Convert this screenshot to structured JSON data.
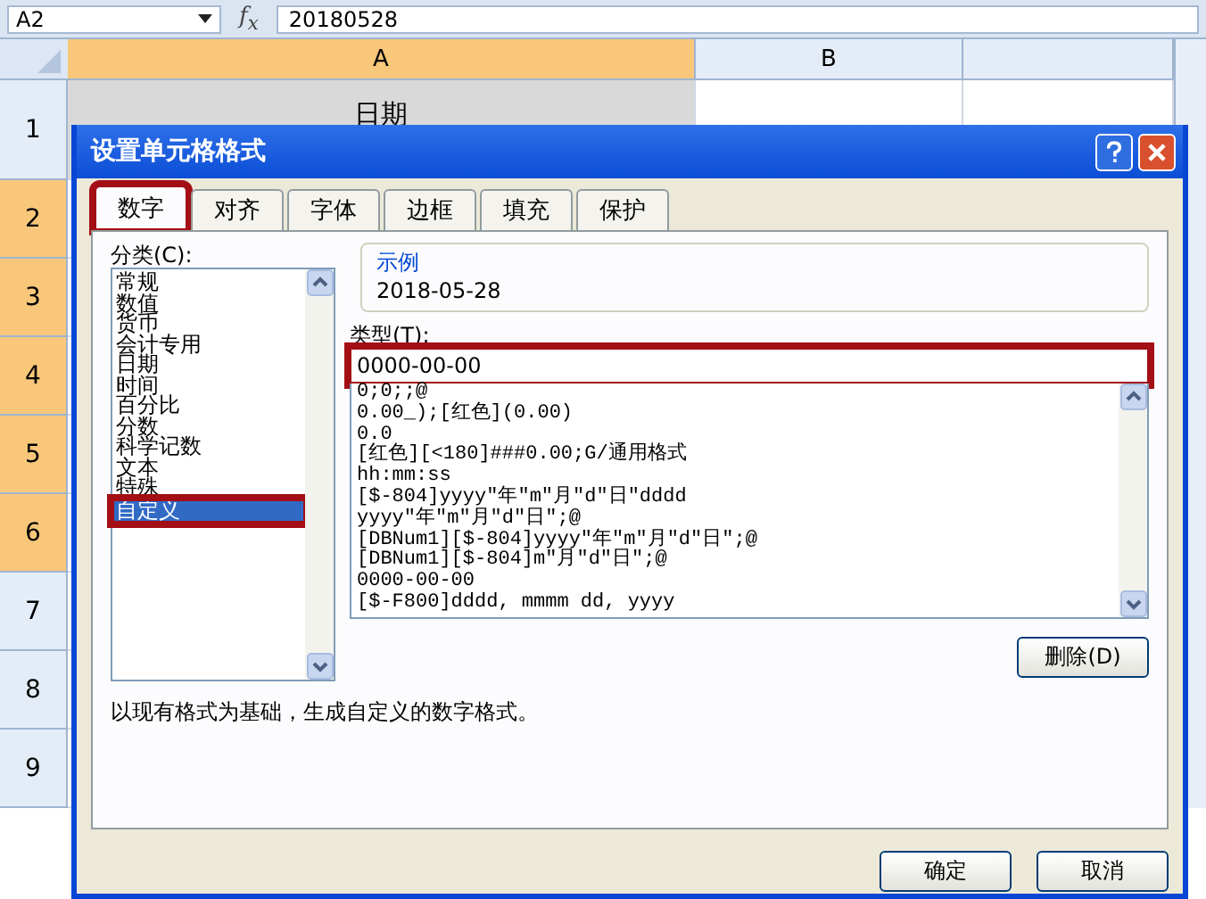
{
  "formula_bar": {
    "name_box": "A2",
    "fx": "f$_{x}$",
    "value": "20180528"
  },
  "columns": [
    {
      "label": "A",
      "selected": true
    },
    {
      "label": "B",
      "selected": false
    }
  ],
  "rows": [
    {
      "label": "1",
      "selected": false
    },
    {
      "label": "2",
      "selected": true
    },
    {
      "label": "3",
      "selected": true
    },
    {
      "label": "4",
      "selected": true
    },
    {
      "label": "5",
      "selected": true
    },
    {
      "label": "6",
      "selected": true
    },
    {
      "label": "7",
      "selected": false
    },
    {
      "label": "8",
      "selected": false
    },
    {
      "label": "9",
      "selected": false
    }
  ],
  "cell_a1": "日期",
  "dialog": {
    "title": "设置单元格格式",
    "tabs": [
      {
        "label": "数字",
        "selected": true,
        "annotated": true
      },
      {
        "label": "对齐",
        "selected": false,
        "annotated": false
      },
      {
        "label": "字体",
        "selected": false,
        "annotated": false
      },
      {
        "label": "边框",
        "selected": false,
        "annotated": false
      },
      {
        "label": "填充",
        "selected": false,
        "annotated": false
      },
      {
        "label": "保护",
        "selected": false,
        "annotated": false
      }
    ],
    "category_label": "分类(C):",
    "categories": [
      {
        "label": "常规",
        "selected": false,
        "annotated": false
      },
      {
        "label": "数值",
        "selected": false,
        "annotated": false
      },
      {
        "label": "货币",
        "selected": false,
        "annotated": false
      },
      {
        "label": "会计专用",
        "selected": false,
        "annotated": false
      },
      {
        "label": "日期",
        "selected": false,
        "annotated": false
      },
      {
        "label": "时间",
        "selected": false,
        "annotated": false
      },
      {
        "label": "百分比",
        "selected": false,
        "annotated": false
      },
      {
        "label": "分数",
        "selected": false,
        "annotated": false
      },
      {
        "label": "科学记数",
        "selected": false,
        "annotated": false
      },
      {
        "label": "文本",
        "selected": false,
        "annotated": false
      },
      {
        "label": "特殊",
        "selected": false,
        "annotated": false
      },
      {
        "label": "自定义",
        "selected": true,
        "annotated": true
      }
    ],
    "sample_label": "示例",
    "sample_value": "2018-05-28",
    "type_label": "类型(T):",
    "type_field": {
      "value": "0000-00-00",
      "annotated": true
    },
    "formats": [
      "0;0;;@",
      "0.00_);[红色](0.00)",
      "0.0",
      "[红色][<180]###0.00;G/通用格式",
      "hh:mm:ss",
      "[$-804]yyyy\"年\"m\"月\"d\"日\"dddd",
      "yyyy\"年\"m\"月\"d\"日\";@",
      "[DBNum1][$-804]yyyy\"年\"m\"月\"d\"日\";@",
      "[DBNum1][$-804]m\"月\"d\"日\";@",
      "0000-00-00",
      "[$-F800]dddd, mmmm dd, yyyy"
    ],
    "delete_button": "删除(D)",
    "description": "以现有格式为基础，生成自定义的数字格式。",
    "ok_button": "确定",
    "cancel_button": "取消"
  }
}
